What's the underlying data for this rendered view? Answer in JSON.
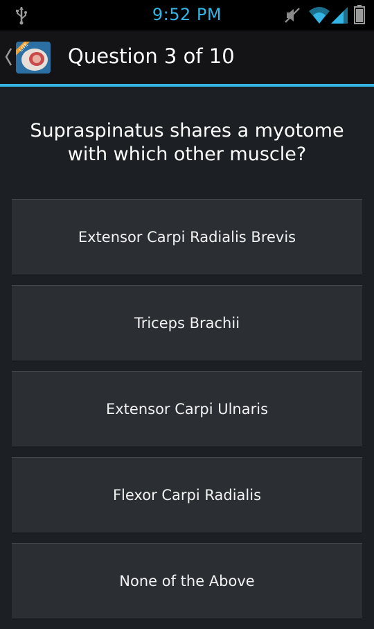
{
  "status_bar": {
    "time": "9:52 PM",
    "accent_color": "#33b5e5",
    "icons": [
      "usb-icon",
      "mute-icon",
      "wifi-icon",
      "signal-icon",
      "battery-icon"
    ]
  },
  "action_bar": {
    "title": "Question 3 of 10",
    "up_icon": "chevron-left-icon",
    "app_icon": "app-icon"
  },
  "question": {
    "text": "Supraspinatus shares a myotome with which other muscle?"
  },
  "answers": [
    {
      "label": "Extensor Carpi Radialis Brevis"
    },
    {
      "label": "Triceps Brachii"
    },
    {
      "label": "Extensor Carpi Ulnaris"
    },
    {
      "label": "Flexor Carpi Radialis"
    },
    {
      "label": "None of the Above"
    }
  ]
}
